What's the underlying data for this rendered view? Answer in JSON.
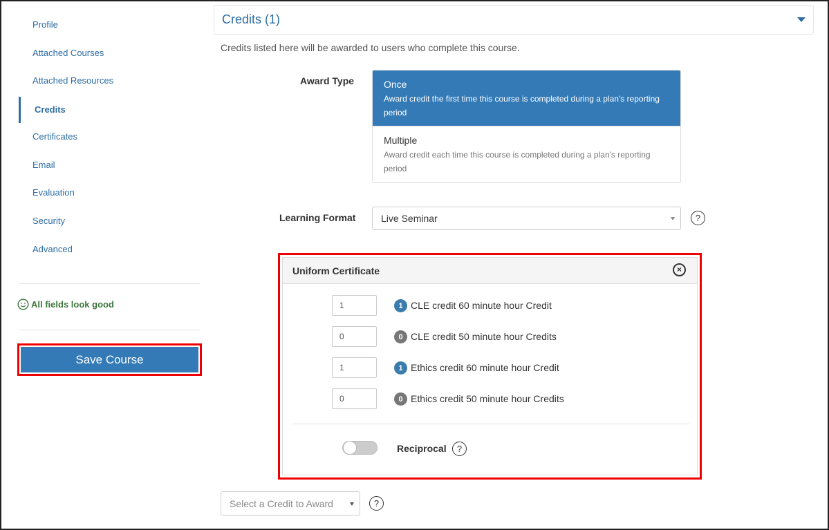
{
  "sidebar": {
    "items": [
      {
        "label": "Profile",
        "active": false
      },
      {
        "label": "Attached Courses",
        "active": false
      },
      {
        "label": "Attached Resources",
        "active": false
      },
      {
        "label": "Credits",
        "active": true
      },
      {
        "label": "Certificates",
        "active": false
      },
      {
        "label": "Email",
        "active": false
      },
      {
        "label": "Evaluation",
        "active": false
      },
      {
        "label": "Security",
        "active": false
      },
      {
        "label": "Advanced",
        "active": false
      }
    ],
    "status_text": "All fields look good",
    "save_label": "Save Course"
  },
  "panel": {
    "title": "Credits (1)",
    "intro": "Credits listed here will be awarded to users who complete this course."
  },
  "award_type": {
    "label": "Award Type",
    "options": [
      {
        "title": "Once",
        "desc": "Award credit the first time this course is completed during a plan's reporting period",
        "selected": true
      },
      {
        "title": "Multiple",
        "desc": "Award credit each time this course is completed during a plan's reporting period",
        "selected": false
      }
    ]
  },
  "learning_format": {
    "label": "Learning Format",
    "value": "Live Seminar",
    "help": "?"
  },
  "certificate": {
    "title": "Uniform Certificate",
    "close": "×",
    "credits": [
      {
        "value": "1",
        "badge": "1",
        "label": "CLE credit 60 minute hour Credit"
      },
      {
        "value": "0",
        "badge": "0",
        "label": "CLE credit 50 minute hour Credits"
      },
      {
        "value": "1",
        "badge": "1",
        "label": "Ethics credit 60 minute hour Credit"
      },
      {
        "value": "0",
        "badge": "0",
        "label": "Ethics credit 50 minute hour Credits"
      }
    ],
    "reciprocal_label": "Reciprocal",
    "reciprocal_on": false,
    "help": "?"
  },
  "award_select": {
    "placeholder": "Select a Credit to Award",
    "help": "?"
  },
  "colors": {
    "accent": "#337ab7",
    "success": "#3c763d",
    "highlight": "#ee0000"
  }
}
